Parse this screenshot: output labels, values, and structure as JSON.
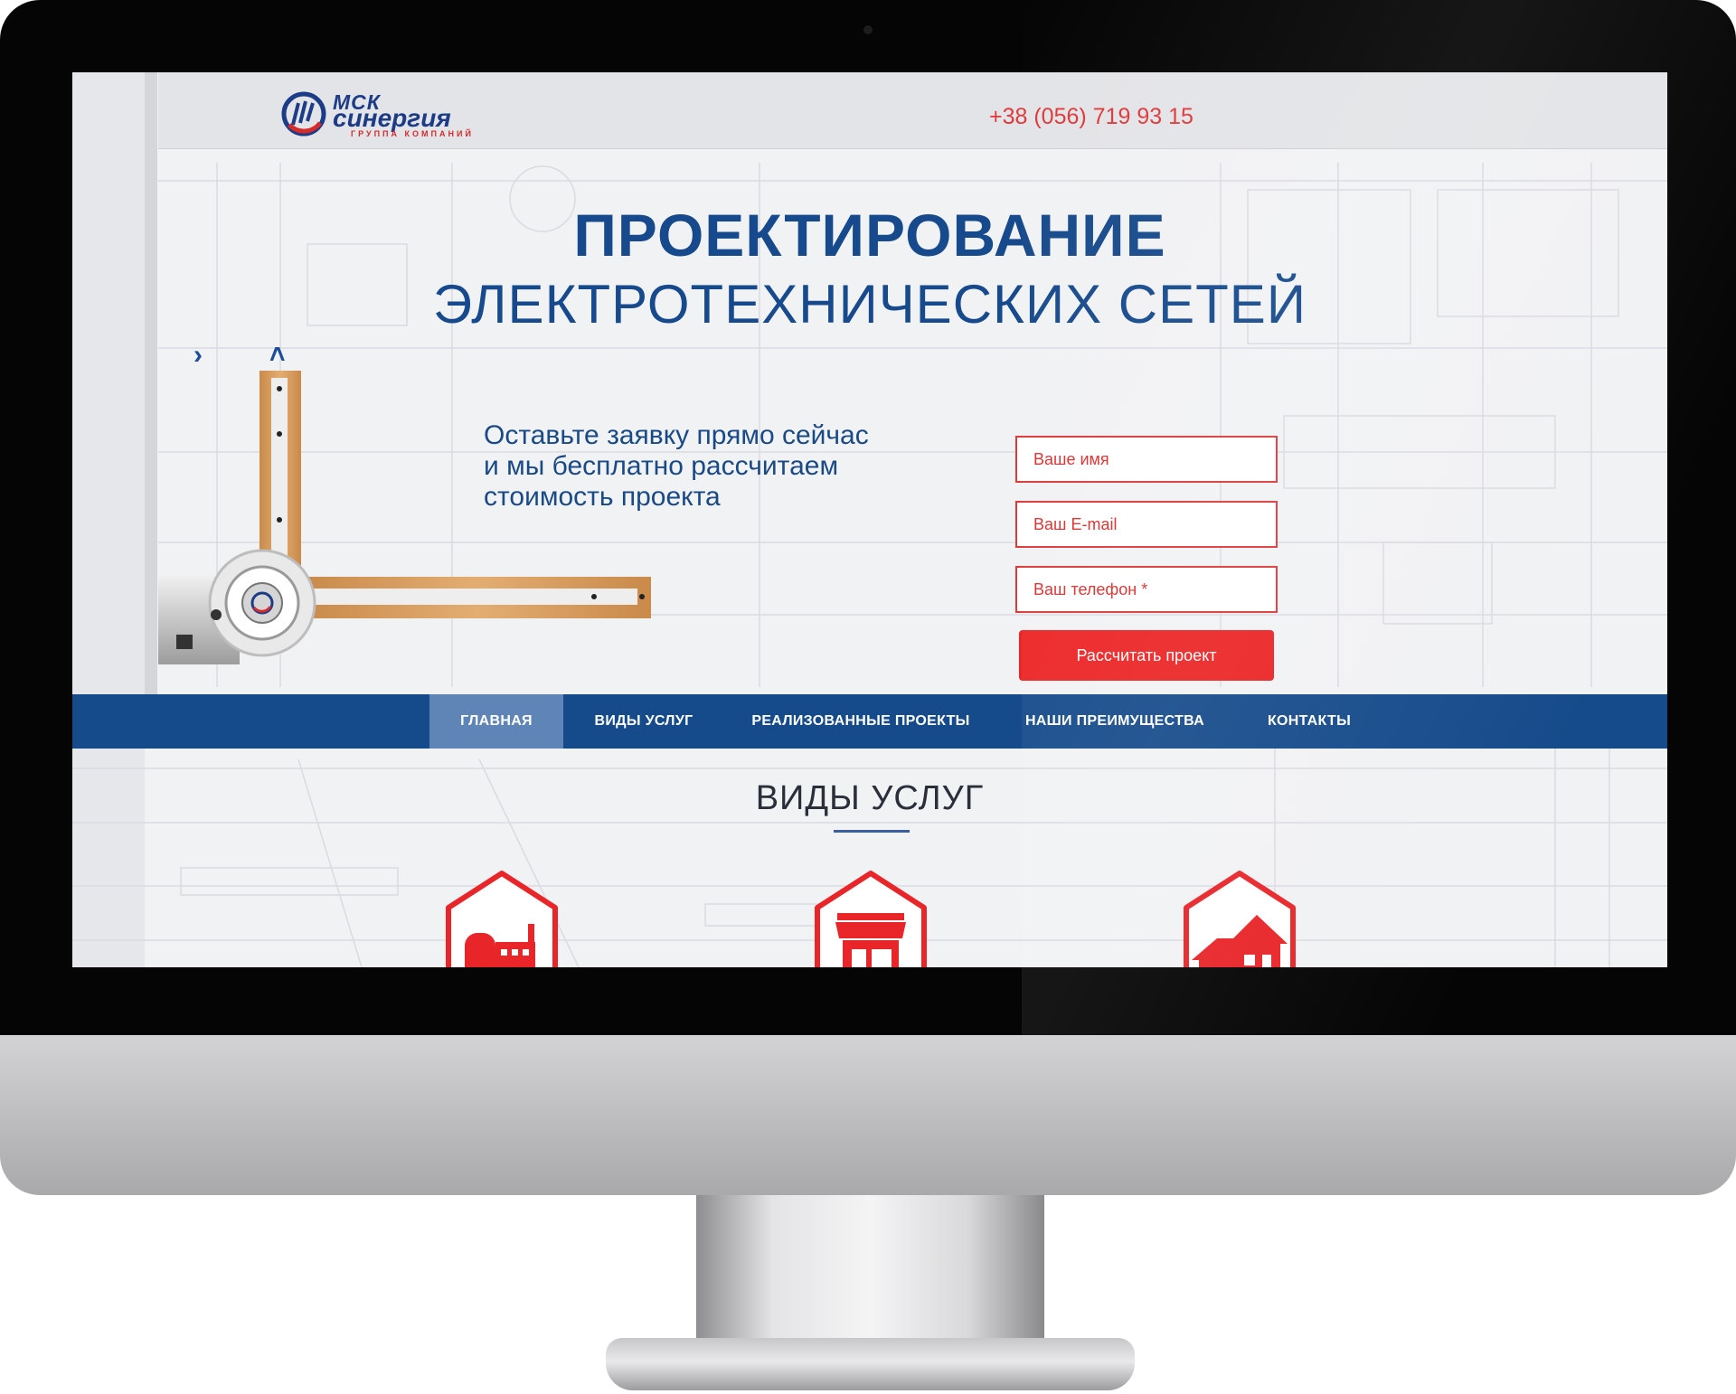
{
  "header": {
    "logo_line1": "МСК",
    "logo_line2": "синергия",
    "logo_tagline": "ГРУППА КОМПАНИЙ",
    "phone": "+38 (056) 719 93 15"
  },
  "hero": {
    "title_line1": "ПРОЕКТИРОВАНИЕ",
    "title_line2": "ЭЛЕКТРОТЕХНИЧЕСКИХ СЕТЕЙ",
    "offer_line1": "Оставьте заявку прямо сейчас",
    "offer_line2": "и мы бесплатно рассчитаем",
    "offer_line3": "стоимость проекта",
    "slider_next_glyph": "›",
    "slider_up_glyph": "˄"
  },
  "form": {
    "name_placeholder": "Ваше имя",
    "email_placeholder": "Ваш E-mail",
    "phone_placeholder": "Ваш телефон *",
    "submit_label": "Рассчитать проект"
  },
  "nav": {
    "items": [
      "ГЛАВНАЯ",
      "ВИДЫ УСЛУГ",
      "РЕАЛИЗОВАННЫЕ ПРОЕКТЫ",
      "НАШИ ПРЕИМУЩЕСТВА",
      "КОНТАКТЫ"
    ],
    "active_index": 0
  },
  "services": {
    "title": "ВИДЫ УСЛУГ",
    "icons": [
      "factory-icon",
      "storefront-icon",
      "house-icon"
    ]
  },
  "colors": {
    "brand_blue": "#164b8b",
    "accent_red": "#ec2526",
    "nav_active": "#5f85b6"
  }
}
